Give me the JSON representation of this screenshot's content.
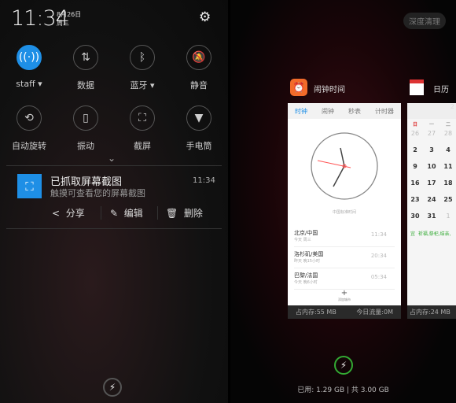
{
  "left": {
    "time": "11:34",
    "date": "8月26日",
    "weekday": "周三",
    "tiles": [
      {
        "label": "staff",
        "icon": "wifi-icon",
        "glyph": "((·))",
        "on": true,
        "dropdown": true
      },
      {
        "label": "数据",
        "icon": "data-icon",
        "glyph": "⇅"
      },
      {
        "label": "蓝牙",
        "icon": "bluetooth-icon",
        "glyph": "ᛒ",
        "dropdown": true
      },
      {
        "label": "静音",
        "icon": "mute-bell-icon",
        "glyph": "🔕"
      },
      {
        "label": "自动旋转",
        "icon": "rotate-lock-icon",
        "glyph": "⟲"
      },
      {
        "label": "振动",
        "icon": "vibrate-icon",
        "glyph": "▯"
      },
      {
        "label": "截屏",
        "icon": "screenshot-icon",
        "glyph": "⛶"
      },
      {
        "label": "手电筒",
        "icon": "flashlight-icon",
        "glyph": "▼"
      }
    ],
    "notification": {
      "title": "已抓取屏幕截图",
      "subtitle": "触摸可查看您的屏幕截图",
      "time": "11:34",
      "actions": {
        "share": "分享",
        "edit": "编辑",
        "delete": "删除"
      }
    }
  },
  "right": {
    "deep_clean": "深度清理",
    "clock_app": {
      "title": "闹钟时间",
      "tabs": [
        "时钟",
        "闹钟",
        "秒表",
        "计时器"
      ],
      "timezone": "中国标准时间",
      "cities": [
        {
          "city": "北京/中国",
          "sub": "今天 周三",
          "time": "11:34"
        },
        {
          "city": "洛杉矶/美国",
          "sub": "昨天 晚15小时",
          "time": "20:34"
        },
        {
          "city": "巴黎/法国",
          "sub": "今天 晚6小时",
          "time": "05:34"
        }
      ],
      "add": "添加城市",
      "memory": "占内存:55 MB",
      "traffic": "今日流量:0M"
    },
    "calendar_app": {
      "title": "日历",
      "header": "2",
      "weekdays": [
        "日",
        "一",
        "二"
      ],
      "days": [
        "26",
        "27",
        "28",
        "2",
        "3",
        "4",
        "9",
        "10",
        "11",
        "16",
        "17",
        "18",
        "23",
        "24",
        "25",
        "30",
        "31",
        "1"
      ],
      "yi": "宜",
      "yi_text": "祈福,祭祀,结亲,",
      "memory": "占内存:24 MB"
    },
    "usage": "已用: 1.29 GB | 共 3.00 GB"
  },
  "colors": {
    "accent": "#1e8fe6",
    "clock_icon": "#f26b2a",
    "second_hand": "#f55",
    "clean_ring": "#33aa33"
  }
}
